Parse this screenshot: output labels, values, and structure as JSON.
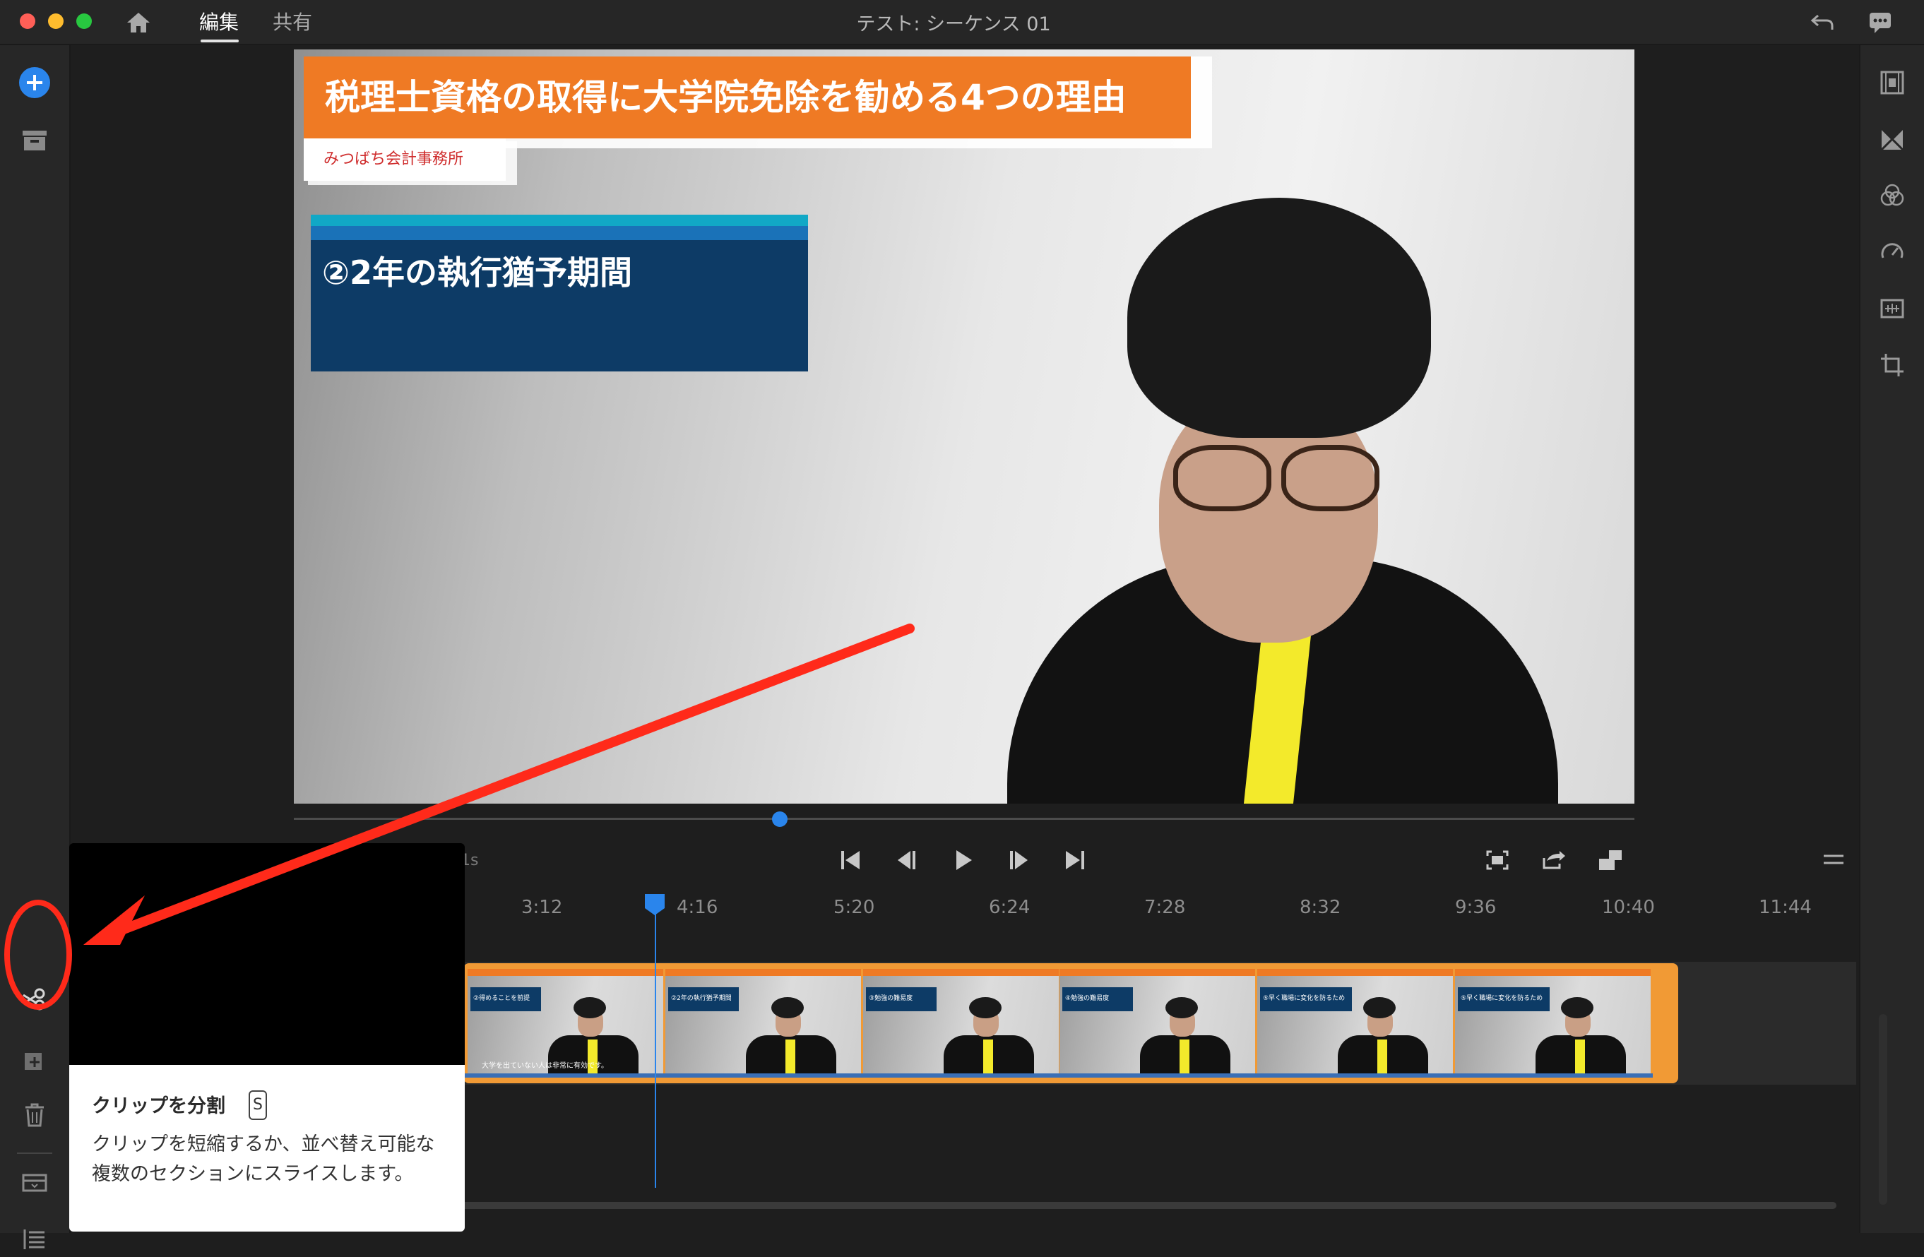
{
  "window": {
    "title": "テスト: シーケンス 01",
    "traffic_lights": [
      "#ff5f57",
      "#febc2e",
      "#28c840"
    ]
  },
  "header": {
    "home_icon": "home-icon",
    "tabs": [
      {
        "label": "編集",
        "active": true
      },
      {
        "label": "共有",
        "active": false
      }
    ],
    "undo_icon": "undo-icon",
    "feedback_icon": "feedback-icon"
  },
  "left_toolbar": [
    "add-media-icon",
    "project-bin-icon",
    "split-clip-icon",
    "add-track-icon",
    "delete-icon",
    "track-height-icon",
    "list-view-icon"
  ],
  "right_toolbar": [
    "transitions-icon",
    "effects-icon",
    "color-icon",
    "speed-icon",
    "audio-icon",
    "crop-icon"
  ],
  "video": {
    "title_overlay": "税理士資格の取得に大学院免除を勧める4つの理由",
    "subtitle_overlay": "みつばち会計事務所",
    "point_text": "②2年の執行猶予期間"
  },
  "transport": [
    "go-to-start-icon",
    "step-back-icon",
    "play-icon",
    "step-forward-icon",
    "go-to-end-icon"
  ],
  "monitor_tools": [
    "fit-frame-icon",
    "export-frame-icon",
    "fullscreen-icon"
  ],
  "timeline": {
    "time_ticks": [
      "3:12",
      "4:16",
      "5:20",
      "6:24",
      "7:28",
      "8:32",
      "9:36",
      "10:40",
      "11:44"
    ],
    "partial_label": "1s",
    "clip_thumbnails": [
      "②得めることを前提",
      "②2年の執行猶予期間",
      "③勉強の難易度",
      "④勉強の難易度",
      "⑤早く職場に変化を防るため",
      "⑤早く職場に変化を防るため"
    ],
    "caption_text": "大学を出ていない人は非常に有効です。"
  },
  "tooltip": {
    "title": "クリップを分割",
    "shortcut": "S",
    "description": "クリップを短縮するか、並べ替え可能な複数のセクションにスライスします。"
  },
  "colors": {
    "accent": "#2a85ec",
    "clip_orange": "#f19a35",
    "title_orange": "#ef7a24",
    "annotation_red": "#ff2a1a",
    "navy": "#0d3b66"
  }
}
